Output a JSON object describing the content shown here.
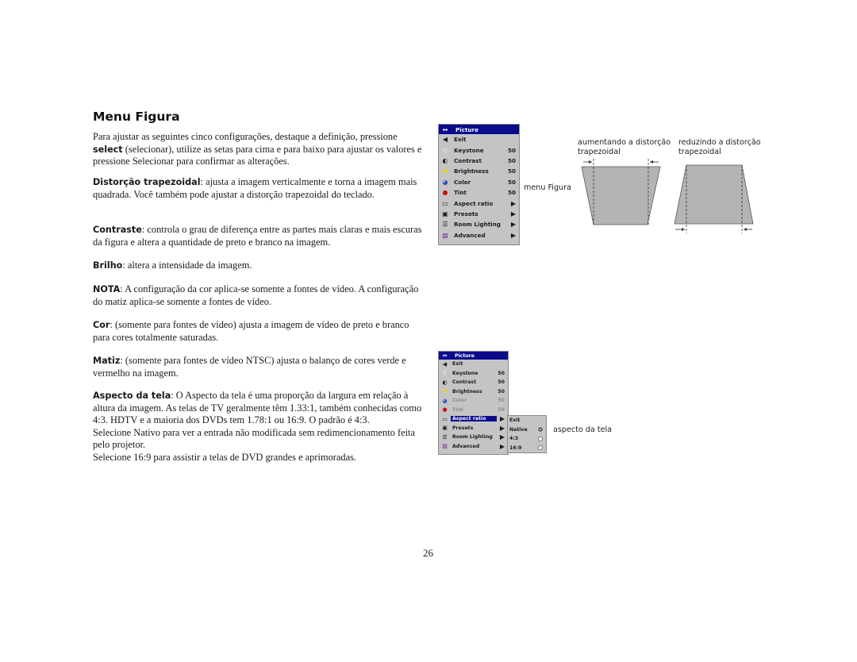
{
  "page": {
    "title": "Menu Figura",
    "page_number": "26"
  },
  "paragraphs": {
    "intro": {
      "pre": "Para ajustar as seguintes cinco configurações, destaque a definição, pressione ",
      "bold": "select",
      "post": " (selecionar), utilize as setas para cima e para baixo para ajustar os valores e pressione Selecionar para confirmar as alterações."
    },
    "keystone": {
      "term": "Distorção trapezoidal",
      "text": ": ajusta a imagem verticalmente e torna a imagem mais quadrada. Você também pode ajustar a distorção trapezoidal do teclado."
    },
    "contrast": {
      "term": "Contraste",
      "text": ": controla o grau de diferença entre as partes mais claras e mais escuras da figura e altera a quantidade de preto e branco na imagem."
    },
    "brightness": {
      "term": "Brilho",
      "text": ": altera a intensidade da imagem."
    },
    "note": {
      "term": "NOTA",
      "text": ": A configuração da cor aplica-se somente a fontes de vídeo. A configuração do matiz aplica-se somente a fontes de vídeo."
    },
    "color": {
      "term": "Cor",
      "text": ": (somente para fontes de vídeo) ajusta a imagem de vídeo de preto e branco para cores totalmente saturadas."
    },
    "tint": {
      "term": "Matiz",
      "text": ": (somente para fontes de vídeo NTSC) ajusta o balanço de cores verde e vermelho na imagem."
    },
    "aspect": {
      "term": "Aspecto da tela",
      "text": ": O Aspecto da tela é uma proporção da largura em relação à altura da imagem. As telas de TV geralmente têm 1.33:1, também conhecidas como 4:3. HDTV e a maioria dos DVDs tem 1.78:1 ou 16:9. O padrão é 4:3.",
      "line2": "Selecione Nativo para ver a entrada não modificada sem redimencionamento feita pelo projetor.",
      "line3": "Selecione 16:9 para assistir a telas de DVD grandes e aprimoradas."
    }
  },
  "picture_menu": {
    "header": "Picture",
    "items": [
      {
        "label": "Exit",
        "icon": "back-arrow-icon"
      },
      {
        "label": "Keystone",
        "value": "50",
        "icon": "keystone-icon"
      },
      {
        "label": "Contrast",
        "value": "50",
        "icon": "contrast-icon"
      },
      {
        "label": "Brightness",
        "value": "50",
        "icon": "brightness-icon"
      },
      {
        "label": "Color",
        "value": "50",
        "icon": "color-icon"
      },
      {
        "label": "Tint",
        "value": "50",
        "icon": "tint-icon"
      },
      {
        "label": "Aspect ratio",
        "submenu": true,
        "icon": "aspect-ratio-icon"
      },
      {
        "label": "Presets",
        "submenu": true,
        "icon": "presets-icon"
      },
      {
        "label": "Room Lighting",
        "submenu": true,
        "icon": "room-lighting-icon"
      },
      {
        "label": "Advanced",
        "submenu": true,
        "icon": "advanced-icon"
      }
    ]
  },
  "aspect_submenu": {
    "items": [
      {
        "label": "Exit"
      },
      {
        "label": "Native",
        "selected": true
      },
      {
        "label": "4:3",
        "selected": false
      },
      {
        "label": "16:9",
        "selected": false
      }
    ]
  },
  "captions": {
    "menu_figure": "menu Figura",
    "increase_keystone_l1": "aumentando a distorção",
    "increase_keystone_l2": "trapezoidal",
    "decrease_keystone_l1": "reduzindo a distorção",
    "decrease_keystone_l2": "trapezoidal",
    "aspect_label": "aspecto da tela"
  },
  "colors": {
    "menu_header": "#0a0a8c",
    "menu_body": "#c4c4c4",
    "trapezoid_fill": "#b4b4b4"
  }
}
